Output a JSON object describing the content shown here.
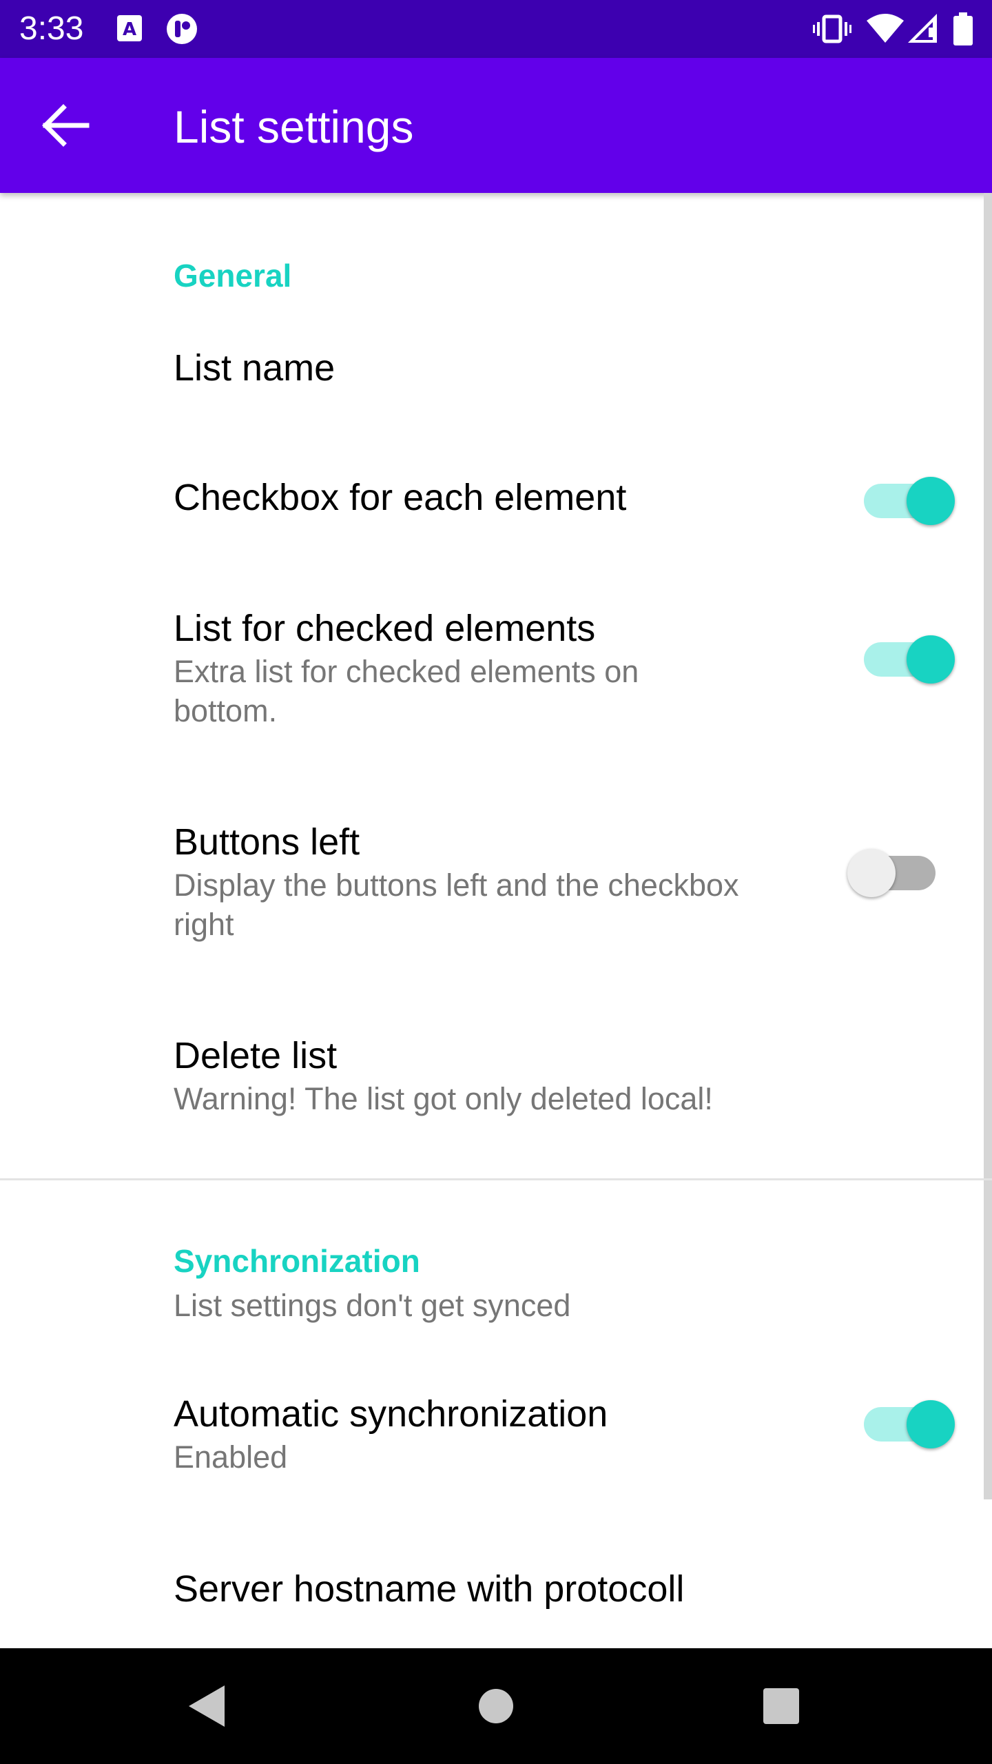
{
  "status_bar": {
    "time": "3:33",
    "left_icons": [
      "a-badge-icon",
      "circle-app-icon"
    ],
    "right_icons": [
      "vibrate-icon",
      "wifi-icon",
      "signal-icon",
      "battery-icon"
    ]
  },
  "app_bar": {
    "back_icon": "arrow-back-icon",
    "title": "List settings"
  },
  "colors": {
    "status_bar": "#3d00b0",
    "app_bar": "#6200ea",
    "accent": "#18d3c2",
    "accent_track": "#a9f1ea"
  },
  "sections": {
    "general": {
      "title": "General",
      "items": {
        "list_name": {
          "title": "List name"
        },
        "checkbox": {
          "title": "Checkbox for each element",
          "checked": true
        },
        "checked_list": {
          "title": "List for checked elements",
          "summary_line1": "Extra list for checked elements on",
          "summary_line2": "bottom.",
          "checked": true
        },
        "buttons_left": {
          "title": "Buttons left",
          "summary_line1": "Display the buttons left and the checkbox",
          "summary_line2": "right",
          "checked": false
        },
        "delete_list": {
          "title": "Delete list",
          "summary": "Warning! The list got only deleted local!"
        }
      }
    },
    "sync": {
      "title": "Synchronization",
      "summary": "List settings don't get synced",
      "items": {
        "auto_sync": {
          "title": "Automatic synchronization",
          "summary": "Enabled",
          "checked": true
        },
        "server_hostname": {
          "title": "Server hostname with protocoll"
        }
      }
    }
  },
  "nav_bar": {
    "back": "nav-back-icon",
    "home": "nav-home-icon",
    "recents": "nav-recents-icon"
  }
}
